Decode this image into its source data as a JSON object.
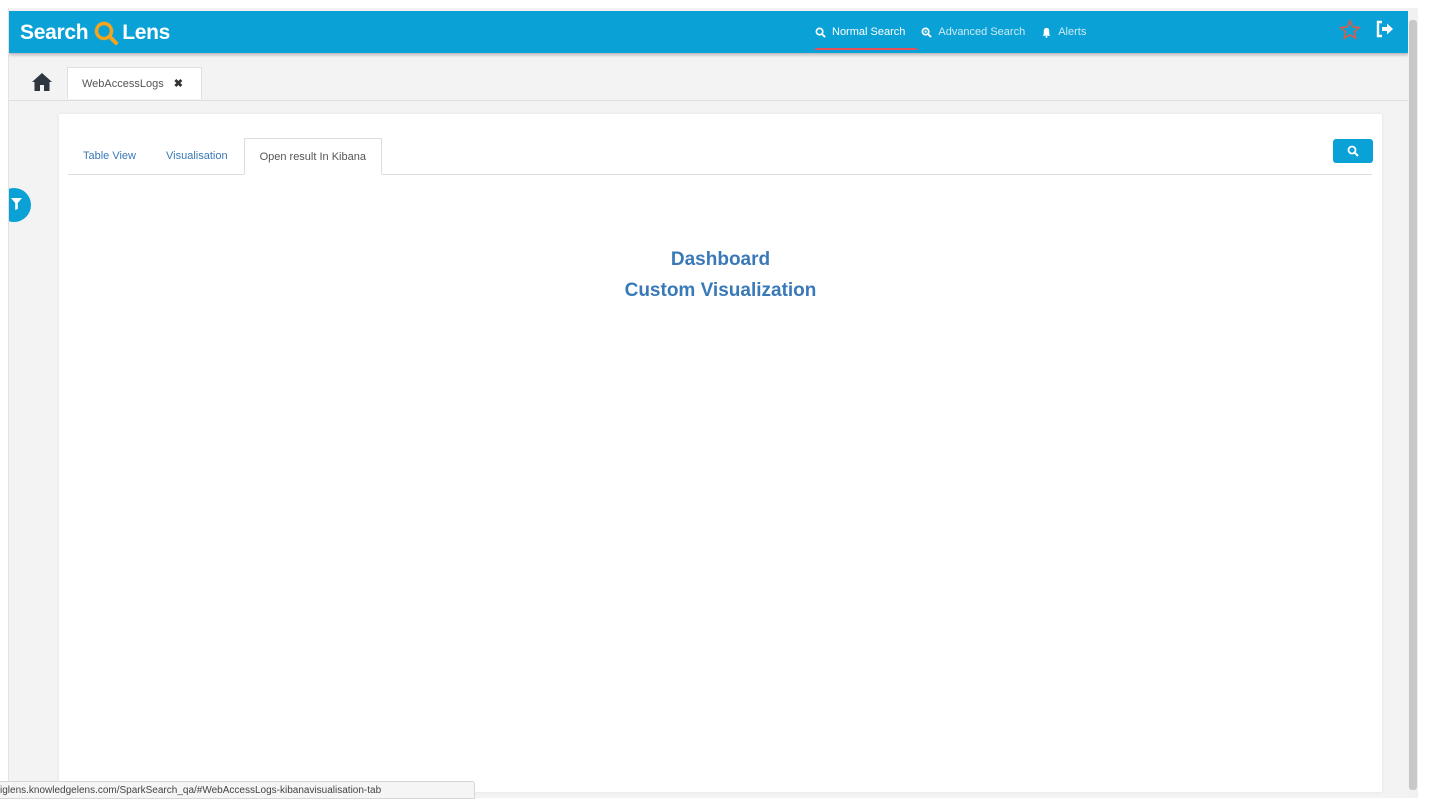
{
  "header": {
    "logo_left": "Search",
    "logo_right": "Lens",
    "nav": [
      {
        "label": "Normal Search",
        "icon": "search-icon",
        "active": true
      },
      {
        "label": "Advanced Search",
        "icon": "advanced-search-icon",
        "active": false
      },
      {
        "label": "Alerts",
        "icon": "bell-icon",
        "active": false
      }
    ],
    "colors": {
      "bar": "#0aa2d6",
      "logo_q": "#f7a41d",
      "active_underline": "#e6505a",
      "star": "#e8573f"
    }
  },
  "doc_tabs": [
    {
      "label": "WebAccessLogs",
      "close": "✖"
    }
  ],
  "panel": {
    "tabs": [
      {
        "label": "Table View",
        "active": false
      },
      {
        "label": "Visualisation",
        "active": false
      },
      {
        "label": "Open result In Kibana",
        "active": true
      }
    ],
    "links": [
      "Dashboard",
      "Custom Visualization"
    ],
    "link_color": "#3a79b7"
  },
  "status_bar": {
    "url": "iglens.knowledgelens.com/SparkSearch_qa/#WebAccessLogs-kibanavisualisation-tab"
  }
}
